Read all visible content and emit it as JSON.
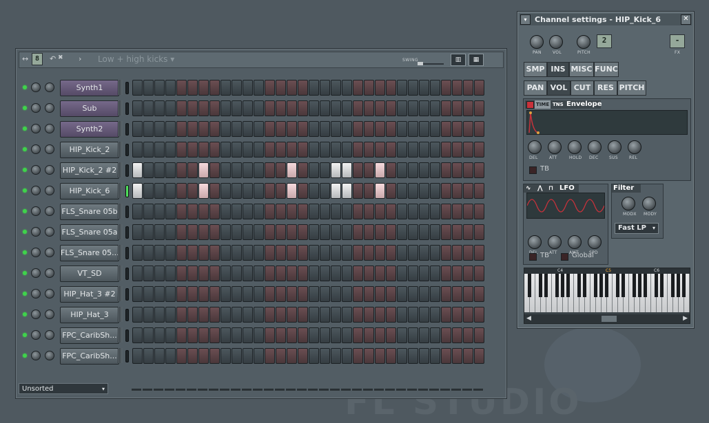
{
  "step_sequencer": {
    "pattern_name": "Low + high kicks",
    "swing_label": "SWING",
    "pattern_number": "8",
    "footer_select": "Unsorted",
    "channels": [
      {
        "name": "Synth1",
        "purple": true,
        "selected": false,
        "on_steps": []
      },
      {
        "name": "Sub",
        "purple": true,
        "selected": false,
        "on_steps": []
      },
      {
        "name": "Synth2",
        "purple": true,
        "selected": false,
        "on_steps": []
      },
      {
        "name": "HIP_Kick_2",
        "purple": false,
        "selected": false,
        "on_steps": []
      },
      {
        "name": "HIP_Kick_2 #2",
        "purple": false,
        "selected": false,
        "on_steps": [
          0,
          6,
          14,
          18,
          19,
          22
        ]
      },
      {
        "name": "HIP_Kick_6",
        "purple": false,
        "selected": true,
        "on_steps": [
          0,
          6,
          14,
          18,
          19,
          22
        ]
      },
      {
        "name": "FLS_Snare 05b",
        "purple": false,
        "selected": false,
        "on_steps": []
      },
      {
        "name": "FLS_Snare 05a",
        "purple": false,
        "selected": false,
        "on_steps": []
      },
      {
        "name": "FLS_Snare 05...",
        "purple": false,
        "selected": false,
        "on_steps": []
      },
      {
        "name": "VT_SD",
        "purple": false,
        "selected": false,
        "on_steps": []
      },
      {
        "name": "HIP_Hat_3 #2",
        "purple": false,
        "selected": false,
        "on_steps": []
      },
      {
        "name": "HIP_Hat_3",
        "purple": false,
        "selected": false,
        "on_steps": []
      },
      {
        "name": "FPC_CaribSh...",
        "purple": false,
        "selected": false,
        "on_steps": []
      },
      {
        "name": "FPC_CaribSh...",
        "purple": false,
        "selected": false,
        "on_steps": []
      }
    ],
    "step_count": 32
  },
  "channel_settings": {
    "title": "Channel settings - HIP_Kick_6",
    "knob_labels": {
      "pan": "PAN",
      "vol": "VOL",
      "pitch": "PITCH",
      "fx": "FX"
    },
    "pitch_range": "2",
    "fx_value": "-",
    "tabs_main": [
      "SMP",
      "INS",
      "MISC",
      "FUNC"
    ],
    "tabs_sub": [
      "PAN",
      "VOL",
      "CUT",
      "RES",
      "PITCH"
    ],
    "envelope": {
      "time_label": "TIME",
      "tns_label": "TNS",
      "title": "Envelope",
      "knobs": [
        "DEL",
        "ATT",
        "HOLD",
        "DEC",
        "SUS",
        "REL"
      ],
      "tb_label": "TB"
    },
    "lfo": {
      "title": "LFO",
      "knobs": [
        "DEL",
        "ATT",
        "AMT",
        "SPD"
      ],
      "tb_label": "TB",
      "global_label": "Global"
    },
    "filter": {
      "title": "Filter",
      "knobs": [
        "MODX",
        "MODY"
      ],
      "type": "Fast LP"
    },
    "keyboard": {
      "octaves": [
        "C4",
        "C5",
        "C6"
      ]
    }
  }
}
